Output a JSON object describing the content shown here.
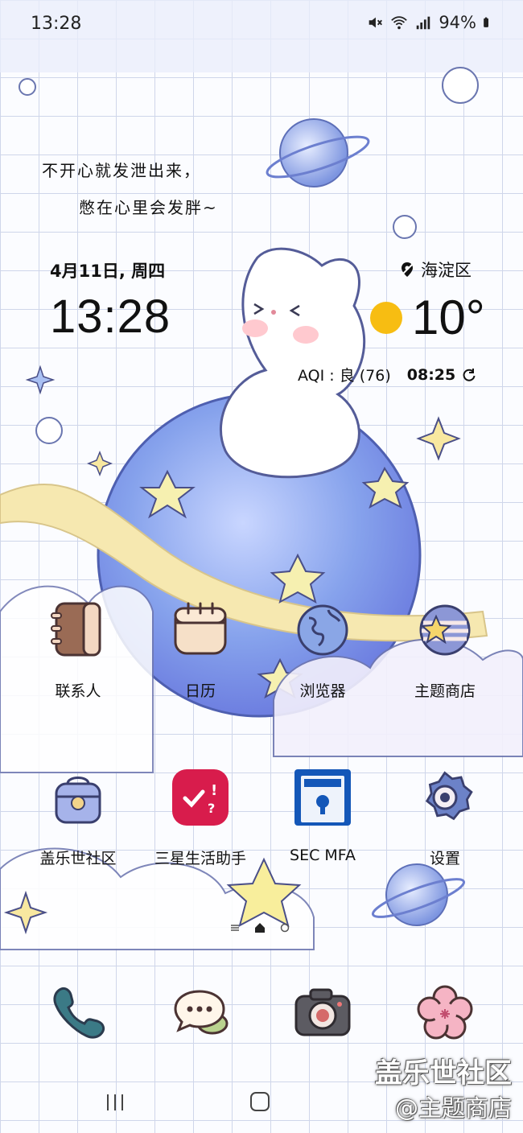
{
  "status_bar": {
    "time": "13:28",
    "battery": "94%",
    "icons": [
      "mute-icon",
      "wifi-icon",
      "signal-icon",
      "battery-icon"
    ]
  },
  "wallpaper": {
    "quote_line1": "不开心就发泄出来，",
    "quote_line2": "憋在心里会发胖~"
  },
  "widget": {
    "date": "4月11日, 周四",
    "time": "13:28",
    "location": "海淀区",
    "temperature": "10°",
    "aqi": "AQI : 良 (76)",
    "update_time": "08:25",
    "weather_icon": "sun-icon"
  },
  "apps": [
    {
      "label": "联系人",
      "icon": "contacts-icon"
    },
    {
      "label": "日历",
      "icon": "calendar-icon"
    },
    {
      "label": "浏览器",
      "icon": "browser-icon"
    },
    {
      "label": "主题商店",
      "icon": "theme-store-icon"
    },
    {
      "label": "盖乐世社区",
      "icon": "community-icon"
    },
    {
      "label": "三星生活助手",
      "icon": "life-assistant-icon"
    },
    {
      "label": "SEC MFA",
      "icon": "sec-mfa-icon"
    },
    {
      "label": "设置",
      "icon": "settings-icon"
    }
  ],
  "dock": [
    "phone-icon",
    "messages-icon",
    "camera-icon",
    "gallery-icon"
  ],
  "watermark": {
    "line1": "盖乐世社区",
    "line2": "@主题商店"
  },
  "colors": {
    "sun": "#f7bd12",
    "planet": "#7f9de8",
    "ring": "#f5e6a8"
  }
}
